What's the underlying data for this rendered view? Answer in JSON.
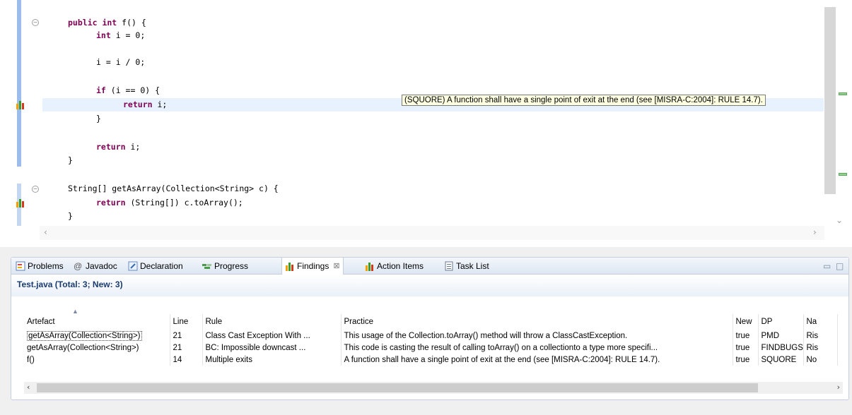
{
  "editor": {
    "code_lines": [
      {
        "kw": "public int",
        "rest": " f() {"
      },
      {
        "kw": "int",
        "rest": " i = 0;"
      },
      {
        "kw": "",
        "rest": "i = i / 0;"
      },
      {
        "kw": "if",
        "rest": " (i == 0) {"
      },
      {
        "kw": "return",
        "rest": " i;"
      },
      {
        "kw": "",
        "rest": "}"
      },
      {
        "kw": "return",
        "rest": " i;"
      },
      {
        "kw": "",
        "rest": "}"
      },
      {
        "kw": "",
        "rest": "String[] getAsArray(Collection<String> c) {"
      },
      {
        "kw": "return",
        "rest": " (String[]) c.toArray();"
      },
      {
        "kw": "",
        "rest": "}"
      }
    ],
    "tooltip": "(SQUORE) A function shall have a single point of exit at the end (see [MISRA-C:2004]: RULE 14.7)."
  },
  "view": {
    "tabs": [
      {
        "label": "Problems",
        "icon": "problems-icon"
      },
      {
        "label": "Javadoc",
        "icon": "javadoc-icon"
      },
      {
        "label": "Declaration",
        "icon": "declaration-icon"
      },
      {
        "label": "Progress",
        "icon": "progress-icon"
      },
      {
        "label": "Findings",
        "icon": "findings-icon",
        "active": true
      },
      {
        "label": "Action Items",
        "icon": "findings-icon"
      },
      {
        "label": "Task List",
        "icon": "tasklist-icon"
      }
    ],
    "subtitle": "Test.java (Total: 3; New: 3)",
    "columns": [
      "Artefact",
      "Line",
      "Rule",
      "Practice",
      "New",
      "DP",
      "Na"
    ],
    "rows": [
      [
        "getAsArray(Collection<String>)",
        "21",
        "Class Cast Exception With ...",
        "This usage of the Collection.toArray() method will throw a ClassCastException.",
        "true",
        "PMD",
        "Ris"
      ],
      [
        "getAsArray(Collection<String>)",
        "21",
        "BC: Impossible downcast ...",
        "This code is casting the result of calling toArray() on a collectionto a type more specifi...",
        "true",
        "FINDBUGS",
        "Ris"
      ],
      [
        "f()",
        "14",
        "Multiple exits",
        "A function shall have a single point of exit at the end (see [MISRA-C:2004]: RULE 14.7).",
        "true",
        "SQUORE",
        "No"
      ]
    ]
  },
  "colors": {
    "keyword": "#7f0055",
    "line_highlight": "#e8f2fe",
    "tooltip_bg": "#ffffe1",
    "subtitle_text": "#1a3c70"
  }
}
